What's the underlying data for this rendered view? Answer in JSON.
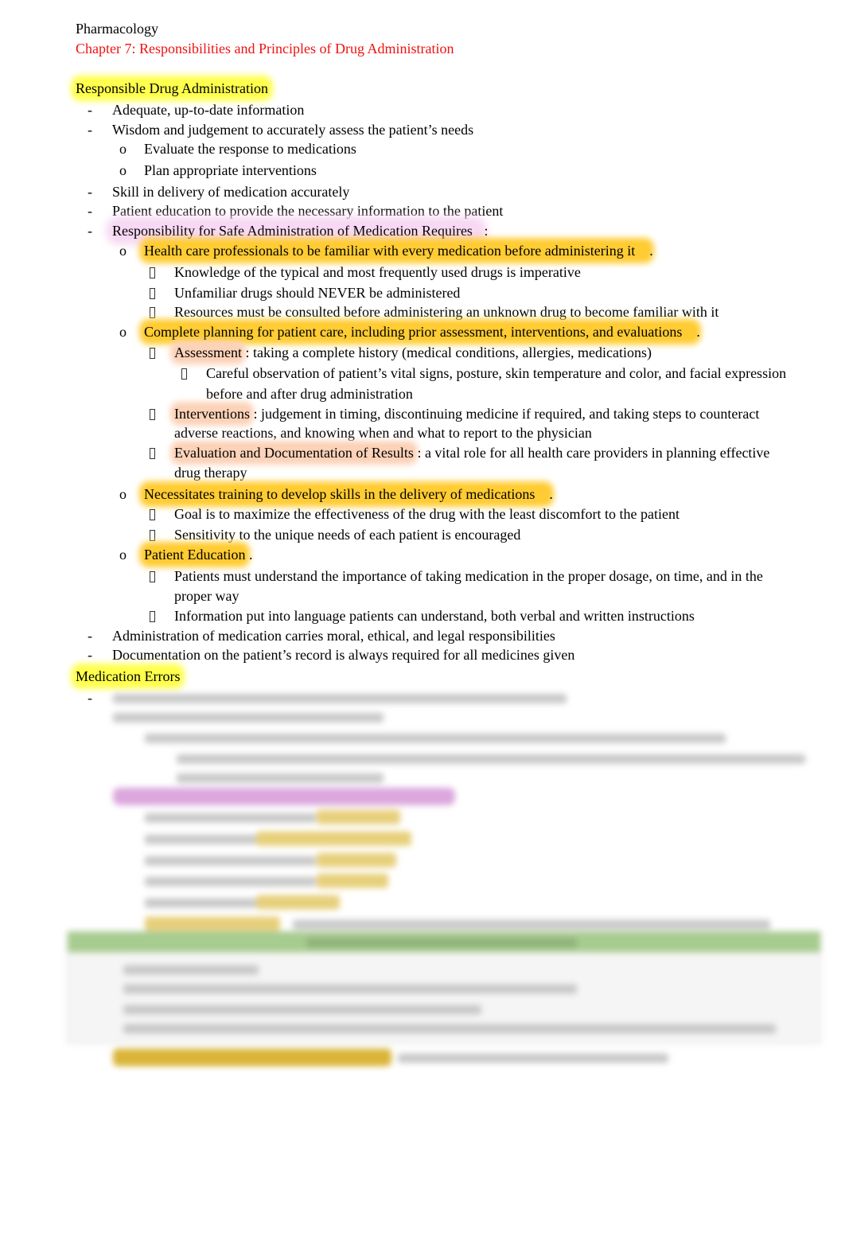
{
  "doc": {
    "title": "Pharmacology",
    "chapter": "Chapter 7: Responsibilities and Principles of Drug Administration",
    "colors": {
      "chapter": "#ee1111",
      "heading_highlight": "#ffff4d",
      "key_highlight": "#ffcc33",
      "term_highlight": "#fcd2b8",
      "pink_highlight": "#f8d8f4",
      "table_header": "#a7cc8f"
    }
  },
  "section1": {
    "heading": "Responsible Drug Administration",
    "items": [
      "Adequate, up-to-date  information",
      "Wisdom and judgement to accurately assess the patient’s needs",
      "Evaluate the response to medications",
      "Plan appropriate interventions",
      "Skill in delivery of medication accurately",
      "Patient education to provide the necessary information to the patient",
      "Responsibility for Safe Administration of Medication Requires",
      ":"
    ],
    "req1": {
      "label": "Health care professionals to be familiar with every medication before administering it",
      "tail": ".",
      "subs": [
        "Knowledge of the typical and most frequently used drugs is imperative",
        "Unfamiliar drugs should NEVER be administered",
        "Resources must be consulted before administering an unknown drug to become familiar with it"
      ]
    },
    "req2": {
      "label": "Complete planning for patient care, including prior assessment, interventions, and evaluations",
      "tail": ".",
      "assessment_term": "Assessment",
      "assessment_text": " : taking a complete history (medical conditions, allergies, medications)",
      "observation_l1": "Careful observation of patient’s vital signs, posture, skin temperature and color, and facial expression",
      "observation_l2": "before and after drug administration",
      "interventions_term": "Interventions",
      "interventions_l1": " : judgement in timing, discontinuing medicine if required, and taking steps to counteract",
      "interventions_l2": "adverse reactions, and knowing when and what to report to the physician",
      "evaluation_term": "Evaluation and Documentation of Results",
      "evaluation_l1": " : a vital role for all health care providers in planning effective",
      "evaluation_l2": "drug therapy"
    },
    "req3": {
      "label": "Necessitates training to develop skills in the delivery of medications",
      "tail": ".",
      "subs": [
        "Goal is to maximize the effectiveness of the drug with the least discomfort to the patient",
        "Sensitivity to the unique needs of each patient is encouraged"
      ]
    },
    "req4": {
      "label": "Patient Education",
      "tail": " .",
      "sub1_l1": "Patients must understand the importance of taking medication in the proper dosage, on time, and in the",
      "sub1_l2": "proper way",
      "sub2": "Information put into language patients can understand, both verbal and written instructions"
    },
    "tail_items": [
      "Administration of medication carries moral, ethical, and legal responsibilities",
      "Documentation  on the patient’s record is   always required  for all medicines given"
    ]
  },
  "section2": {
    "heading": "Medication Errors",
    "blurred": true
  },
  "markers": {
    "dash": "-",
    "circle": "o"
  }
}
